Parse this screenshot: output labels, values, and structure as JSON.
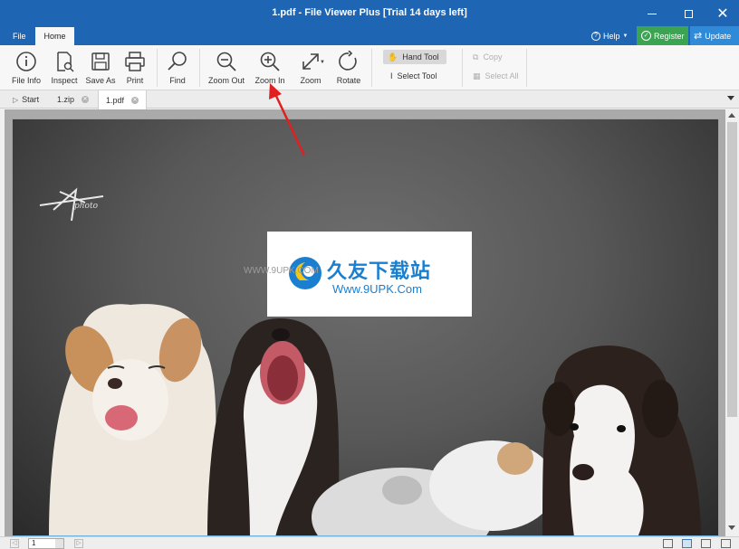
{
  "window": {
    "title": "1.pdf - File Viewer Plus [Trial 14 days left]"
  },
  "menubar": {
    "file_label": "File",
    "home_label": "Home",
    "help_label": "Help",
    "register_label": "Register",
    "update_label": "Update"
  },
  "ribbon": {
    "file_info": "File Info",
    "inspect": "Inspect",
    "save_as": "Save As",
    "print": "Print",
    "find": "Find",
    "zoom_out": "Zoom Out",
    "zoom_in": "Zoom In",
    "zoom": "Zoom",
    "rotate": "Rotate",
    "hand_tool": "Hand Tool",
    "select_tool": "Select Tool",
    "copy": "Copy",
    "select_all": "Select All"
  },
  "tabs": [
    {
      "label": "Start"
    },
    {
      "label": "1.zip"
    },
    {
      "label": "1.pdf"
    }
  ],
  "watermark": {
    "chinese": "久友下载站",
    "url_small": "WWW.9UPK.COM",
    "url_large": "Www.9UPK.Com"
  },
  "photo": {
    "signature": "photo"
  },
  "statusbar": {
    "page": "1"
  },
  "colors": {
    "titlebar": "#1e66b4",
    "register": "#3ba452",
    "update": "#2f8ad8",
    "annotation": "#e02020"
  }
}
